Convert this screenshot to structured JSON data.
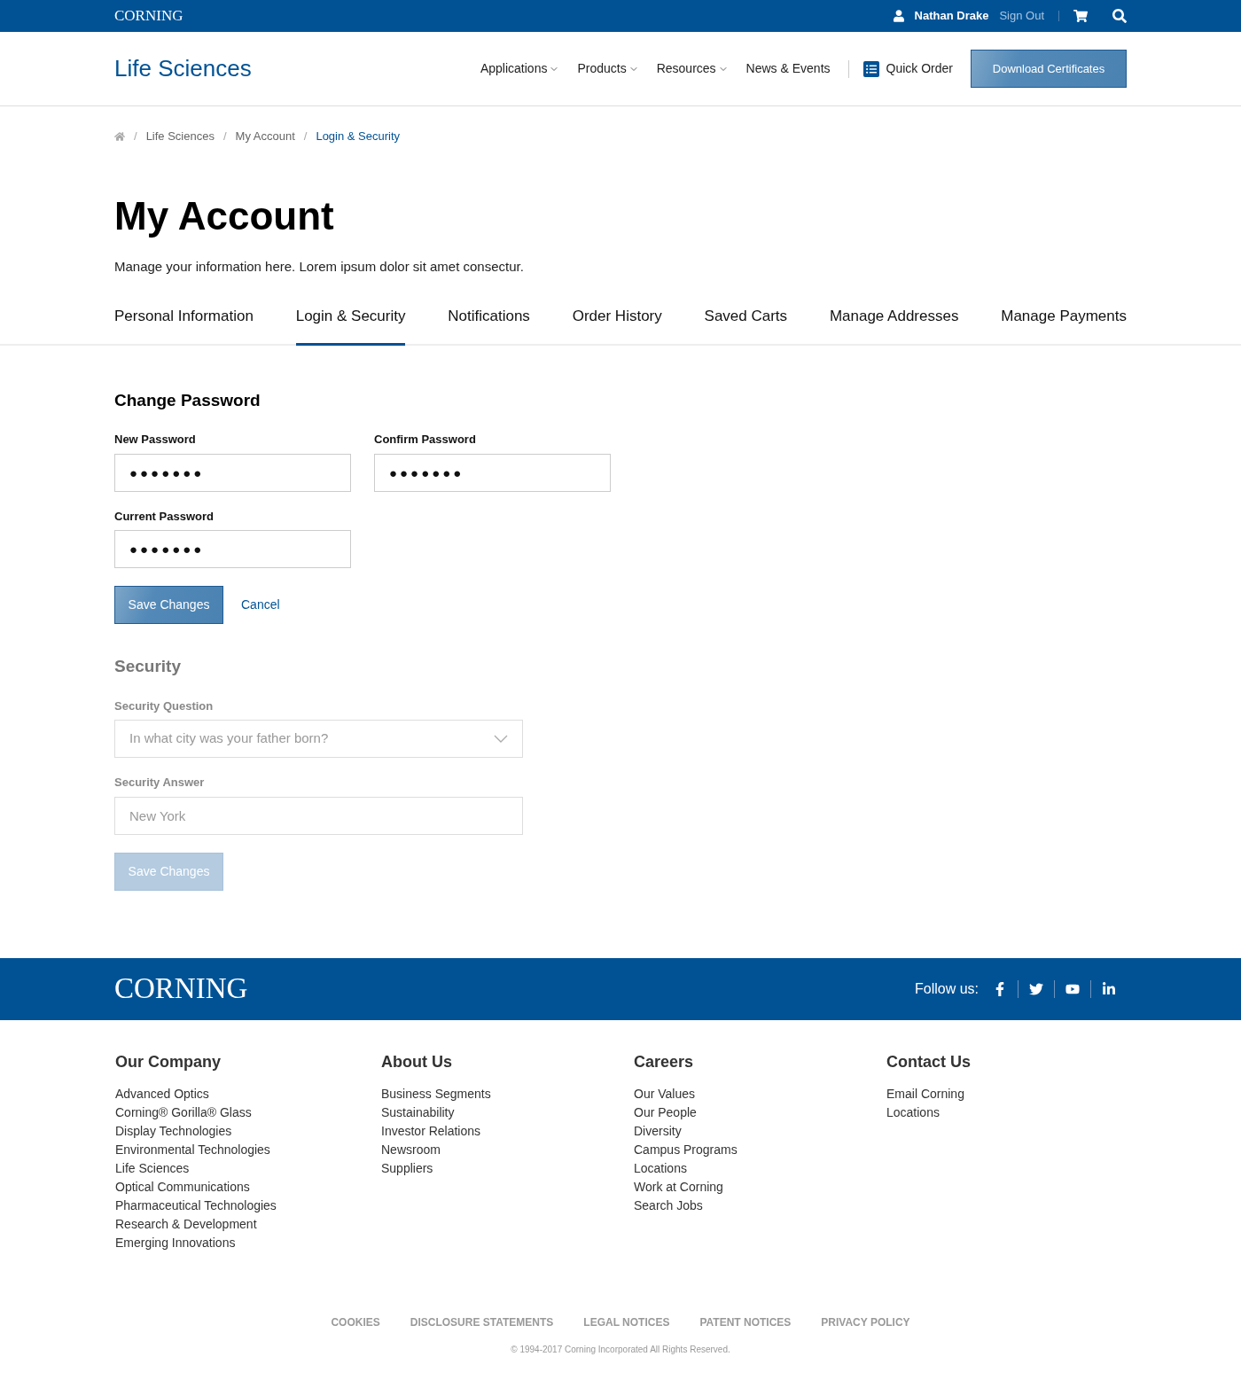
{
  "top_bar": {
    "logo": "CORNING",
    "user": "Nathan Drake",
    "sign_out": "Sign Out"
  },
  "header": {
    "site_title": "Life Sciences",
    "nav": [
      {
        "label": "Applications",
        "dropdown": true
      },
      {
        "label": "Products",
        "dropdown": true
      },
      {
        "label": "Resources",
        "dropdown": true
      },
      {
        "label": "News & Events",
        "dropdown": false
      }
    ],
    "quick_order": "Quick Order",
    "download_button": "Download Certificates"
  },
  "breadcrumb": [
    {
      "separator": "/",
      "label": "Life Sciences",
      "selected": false
    },
    {
      "separator": "/",
      "label": "My Account",
      "selected": false
    },
    {
      "separator": "/",
      "label": "Login & Security",
      "selected": true
    }
  ],
  "page": {
    "title": "My Account",
    "intro": "Manage your information here. Lorem ipsum dolor sit amet consectur."
  },
  "tabs": [
    {
      "label": "Personal Information",
      "selected": false
    },
    {
      "label": "Login & Security",
      "selected": true
    },
    {
      "label": "Notifications",
      "selected": false
    },
    {
      "label": "Order History",
      "selected": false
    },
    {
      "label": "Saved Carts",
      "selected": false
    },
    {
      "label": "Manage Addresses",
      "selected": false
    },
    {
      "label": "Manage Payments",
      "selected": false
    }
  ],
  "change_password": {
    "title": "Change Password",
    "disabled": false,
    "fields": [
      {
        "label": "New Password",
        "value": "●●●●●●●",
        "kind": "text"
      },
      {
        "label": "Confirm Password",
        "value": "●●●●●●●",
        "kind": "text"
      },
      {
        "label": "Current Password",
        "value": "●●●●●●●",
        "kind": "text"
      }
    ],
    "save": "Save Changes",
    "cancel": "Cancel"
  },
  "security": {
    "title": "Security",
    "disabled": true,
    "fields": [
      {
        "label": "Security Question",
        "value": "In what city was your father born?",
        "kind": "select"
      },
      {
        "label": "Security Answer",
        "value": "New York",
        "kind": "text"
      }
    ],
    "save": "Save Changes"
  },
  "footer": {
    "logo": "CORNING",
    "follow": "Follow us:",
    "columns": [
      {
        "title": "Our Company",
        "links": [
          "Advanced Optics",
          "Corning® Gorilla® Glass",
          "Display Technologies",
          "Environmental Technologies",
          "Life Sciences",
          "Optical Communications",
          "Pharmaceutical Technologies",
          "Research & Development",
          "Emerging Innovations"
        ]
      },
      {
        "title": "About Us",
        "links": [
          "Business Segments",
          "Sustainability",
          "Investor Relations",
          "Newsroom",
          "Suppliers"
        ]
      },
      {
        "title": "Careers",
        "links": [
          "Our Values",
          "Our People",
          "Diversity",
          "Campus Programs",
          "Locations",
          "Work at Corning",
          "Search Jobs"
        ]
      },
      {
        "title": "Contact Us",
        "links": [
          "Email Corning",
          "Locations"
        ]
      }
    ],
    "legal": [
      "COOKIES",
      "DISCLOSURE STATEMENTS",
      "LEGAL NOTICES",
      "PATENT NOTICES",
      "PRIVACY POLICY"
    ],
    "copyright": "© 1994-2017 Corning Incorporated All Rights Reserved."
  }
}
